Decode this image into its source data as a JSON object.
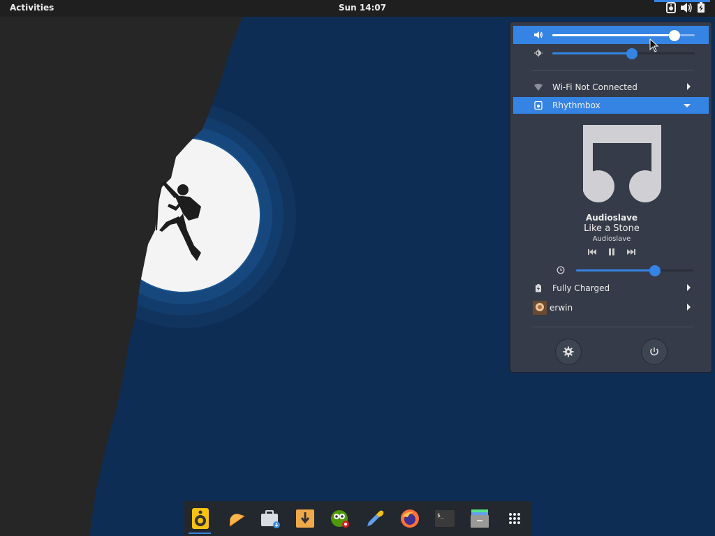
{
  "top_bar": {
    "activities_label": "Activities",
    "clock": "Sun 14:07",
    "tray_icons": [
      "rhythmbox-icon",
      "volume-icon",
      "battery-icon"
    ]
  },
  "system_menu": {
    "volume": {
      "icon": "volume-icon",
      "level": 0.86
    },
    "brightness": {
      "icon": "brightness-icon",
      "level": 0.56
    },
    "wifi": {
      "icon": "wifi-icon",
      "label": "Wi-Fi Not Connected"
    },
    "media": {
      "player_label": "Rhythmbox",
      "player_icon": "rhythmbox-icon",
      "art_icon": "music-note-icon",
      "artist": "Audioslave",
      "title": "Like a Stone",
      "album": "Audioslave",
      "controls": [
        "previous-icon",
        "pause-icon",
        "next-icon"
      ],
      "position_icon": "clock-icon",
      "position": 0.67
    },
    "battery": {
      "icon": "battery-icon",
      "label": "Fully Charged"
    },
    "user": {
      "avatar": "user-avatar",
      "label": "erwin"
    },
    "buttons": [
      "settings-icon",
      "power-icon"
    ]
  },
  "dock": {
    "apps": [
      "rhythmbox",
      "orange-app",
      "software-center",
      "download-manager",
      "gimp-app",
      "color-picker",
      "firefox",
      "terminal",
      "file-manager",
      "show-applications"
    ],
    "running": "rhythmbox"
  },
  "colors": {
    "accent": "#3584e4",
    "panel": "#1f1f1f",
    "menu_bg": "#353b48",
    "wallpaper_sky": "#0f2e55",
    "cliff": "#262626"
  }
}
